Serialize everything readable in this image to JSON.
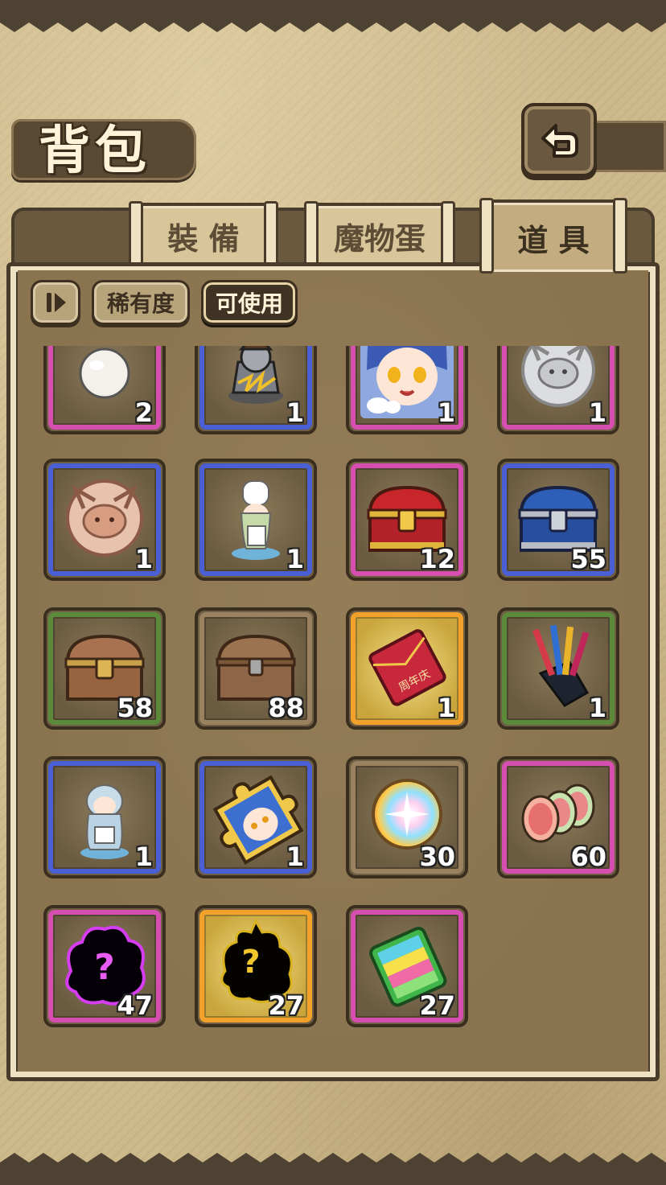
{
  "header": {
    "title": "背包"
  },
  "tabs": [
    {
      "label": "裝 備",
      "active": false
    },
    {
      "label": "魔物蛋",
      "active": false
    },
    {
      "label": "道 具",
      "active": true
    }
  ],
  "filters": {
    "rarity": "稀有度",
    "usable": "可使用"
  },
  "colors": {
    "pink": "#d64fb0",
    "blue": "#4a5fd4",
    "green": "#5b8a3a",
    "brown": "#9a8160",
    "orange": "#f2a12a"
  },
  "items": [
    {
      "icon": "white-ball-icon",
      "count": "2",
      "rarity": "pink"
    },
    {
      "icon": "armored-monster-icon",
      "count": "1",
      "rarity": "blue"
    },
    {
      "icon": "catgirl-portrait-icon",
      "count": "1",
      "rarity": "pink"
    },
    {
      "icon": "silver-season-medal-icon",
      "count": "1",
      "rarity": "pink"
    },
    {
      "icon": "bronze-season-medal-icon",
      "count": "1",
      "rarity": "blue"
    },
    {
      "icon": "chef-figure-icon",
      "count": "1",
      "rarity": "blue"
    },
    {
      "icon": "red-treasure-chest-icon",
      "count": "12",
      "rarity": "pink"
    },
    {
      "icon": "blue-treasure-chest-icon",
      "count": "55",
      "rarity": "blue"
    },
    {
      "icon": "wooden-chest-icon",
      "count": "58",
      "rarity": "green"
    },
    {
      "icon": "plain-wooden-chest-icon",
      "count": "88",
      "rarity": "brown"
    },
    {
      "icon": "red-envelope-icon",
      "count": "1",
      "rarity": "orange",
      "text": "周年庆"
    },
    {
      "icon": "fireworks-bundle-icon",
      "count": "1",
      "rarity": "green"
    },
    {
      "icon": "maid-figure-icon",
      "count": "1",
      "rarity": "blue"
    },
    {
      "icon": "puzzle-piece-icon",
      "count": "1",
      "rarity": "blue"
    },
    {
      "icon": "rainbow-orb-icon",
      "count": "30",
      "rarity": "brown"
    },
    {
      "icon": "meat-slices-icon",
      "count": "60",
      "rarity": "pink"
    },
    {
      "icon": "mystery-monster-purple-icon",
      "count": "47",
      "rarity": "pink",
      "text": "?"
    },
    {
      "icon": "mystery-monster-gold-icon",
      "count": "27",
      "rarity": "orange",
      "text": "?"
    },
    {
      "icon": "rainbow-book-icon",
      "count": "27",
      "rarity": "pink"
    }
  ]
}
